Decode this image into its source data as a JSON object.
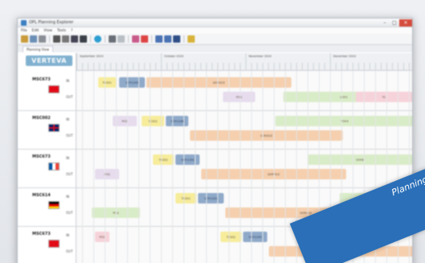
{
  "window": {
    "title": "OPL Planning Explorer"
  },
  "menu": [
    "File",
    "Edit",
    "View",
    "Tools",
    "?"
  ],
  "doc_tab": "Planning View",
  "logo_text": "VERTEVA",
  "header": {
    "months": [
      "September 2024",
      "October 2024",
      "November 2024",
      "December 2024"
    ]
  },
  "vessels": [
    {
      "name": "MSC673",
      "flag": "turkey",
      "sub": [
        "IN",
        "OUT"
      ],
      "bars": [
        {
          "t": "TC001",
          "c": "yellow"
        },
        {
          "t": "VOY1245",
          "c": "blue"
        },
        {
          "t": "SERVICE",
          "c": "peach"
        },
        {
          "t": "VOY2",
          "c": "green"
        },
        {
          "t": "POS",
          "c": "lav"
        },
        {
          "t": "TC",
          "c": "pink"
        }
      ]
    },
    {
      "name": "MSC002",
      "flag": "uk",
      "sub": [
        "IN",
        "OUT"
      ],
      "bars": [
        {
          "t": "POS",
          "c": "lav"
        },
        {
          "t": "TC001",
          "c": "yellow"
        },
        {
          "t": "VOY1246",
          "c": "blue"
        },
        {
          "t": "SERVICE",
          "c": "peach"
        },
        {
          "t": "VOY4",
          "c": "green"
        }
      ]
    },
    {
      "name": "MSC673",
      "flag": "france",
      "sub": [
        "IN",
        "OUT"
      ],
      "bars": [
        {
          "t": "POS",
          "c": "lav"
        },
        {
          "t": "TC001",
          "c": "yellow"
        },
        {
          "t": "VOY1250",
          "c": "blue"
        },
        {
          "t": "SERVICE",
          "c": "peach"
        },
        {
          "t": "VOY6",
          "c": "green"
        }
      ]
    },
    {
      "name": "MSC614",
      "flag": "germany",
      "sub": [
        "IN",
        "OUT"
      ],
      "bars": [
        {
          "t": "POS",
          "c": "green"
        },
        {
          "t": "TC001",
          "c": "yellow"
        },
        {
          "t": "VOY1252",
          "c": "blue"
        },
        {
          "t": "SERVICE",
          "c": "peach"
        },
        {
          "t": "VOY7",
          "c": "green"
        }
      ]
    },
    {
      "name": "MSC673",
      "flag": "turkey",
      "sub": [
        "IN",
        "OUT"
      ],
      "bars": [
        {
          "t": "POS",
          "c": "pink"
        },
        {
          "t": "TC001",
          "c": "yellow"
        },
        {
          "t": "VOY1255",
          "c": "blue"
        },
        {
          "t": "SERVICE",
          "c": "peach"
        }
      ]
    }
  ],
  "colors": {
    "yellow": "#f6ec9a",
    "blue": "#8fa9c9",
    "peach": "#f5cfae",
    "green": "#d9ecc8",
    "lav": "#e6dcee",
    "pink": "#f6d3da"
  },
  "ribbon_text": "Planning"
}
